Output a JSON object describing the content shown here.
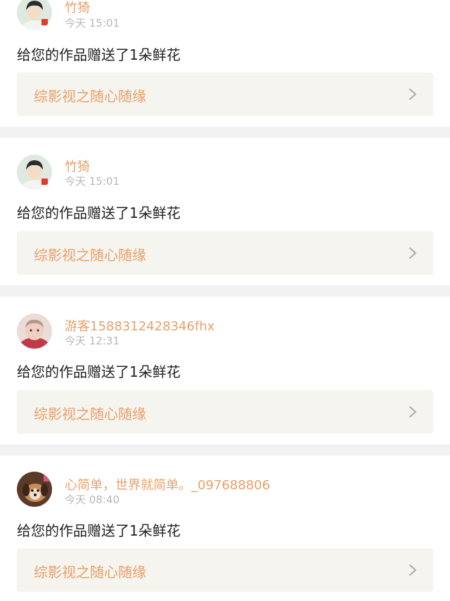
{
  "feed": {
    "items": [
      {
        "username": "竹猗",
        "time": "今天 15:01",
        "message": "给您的作品赠送了1朵鲜花",
        "work_title": "综影视之随心随缘",
        "avatar_icon": "avatar-young-man"
      },
      {
        "username": "竹猗",
        "time": "今天 15:01",
        "message": "给您的作品赠送了1朵鲜花",
        "work_title": "综影视之随心随缘",
        "avatar_icon": "avatar-young-man"
      },
      {
        "username": "游客1588312428346fhx",
        "time": "今天 12:31",
        "message": "给您的作品赠送了1朵鲜花",
        "work_title": "综影视之随心随缘",
        "avatar_icon": "avatar-baby"
      },
      {
        "username": "心简单，世界就简单。_097688806",
        "time": "今天 08:40",
        "message": "给您的作品赠送了1朵鲜花",
        "work_title": "综影视之随心随缘",
        "avatar_icon": "avatar-dog"
      }
    ]
  },
  "colors": {
    "accent": "#e8a06c",
    "link_bg": "#f5f4ee",
    "separator": "#f2f2f2",
    "time_gray": "#b8b8b8"
  }
}
